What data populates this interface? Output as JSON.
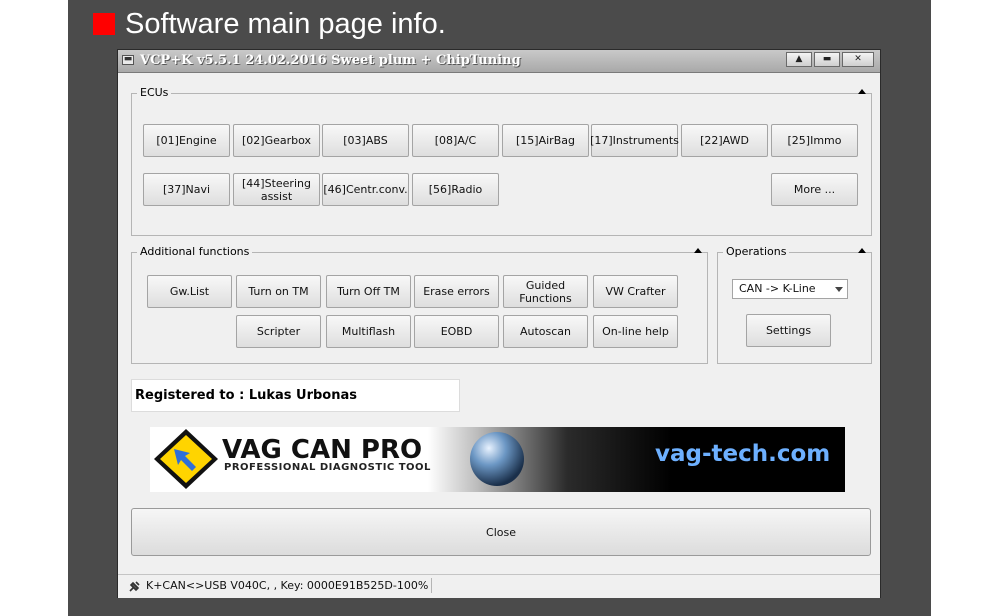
{
  "slide": {
    "title": "Software main page info."
  },
  "window": {
    "title": "VCP+K v5.5.1 24.02.2016 Sweet plum + ChipTuning",
    "controls": {
      "sysmenu": "▬",
      "restore": "▲",
      "minimize": "▬",
      "close": "✕"
    }
  },
  "ecus": {
    "label": "ECUs",
    "row1": [
      "[01]Engine",
      "[02]Gearbox",
      "[03]ABS",
      "[08]A/C",
      "[15]AirBag",
      "[17]Instruments",
      "[22]AWD",
      "[25]Immo"
    ],
    "row2": [
      "[37]Navi",
      "[44]Steering\nassist",
      "[46]Centr.conv.",
      "[56]Radio"
    ],
    "more": "More ..."
  },
  "additional": {
    "label": "Additional functions",
    "row1": [
      "Gw.List",
      "Turn on TM",
      "Turn Off TM",
      "Erase errors",
      "Guided\nFunctions",
      "VW Crafter"
    ],
    "row2": [
      "Scripter",
      "Multiflash",
      "EOBD",
      "Autoscan",
      "On-line help"
    ]
  },
  "operations": {
    "label": "Operations",
    "interface_value": "CAN -> K-Line",
    "settings": "Settings"
  },
  "registered": "Registered to : Lukas Urbonas",
  "banner": {
    "main": "VAG CAN PRO",
    "sub": "PROFESSIONAL DIAGNOSTIC TOOL",
    "site": "vag-tech.com"
  },
  "close_label": "Close",
  "status": "K+CAN<>USB V040C, , Key: 0000E91B525D-100%"
}
